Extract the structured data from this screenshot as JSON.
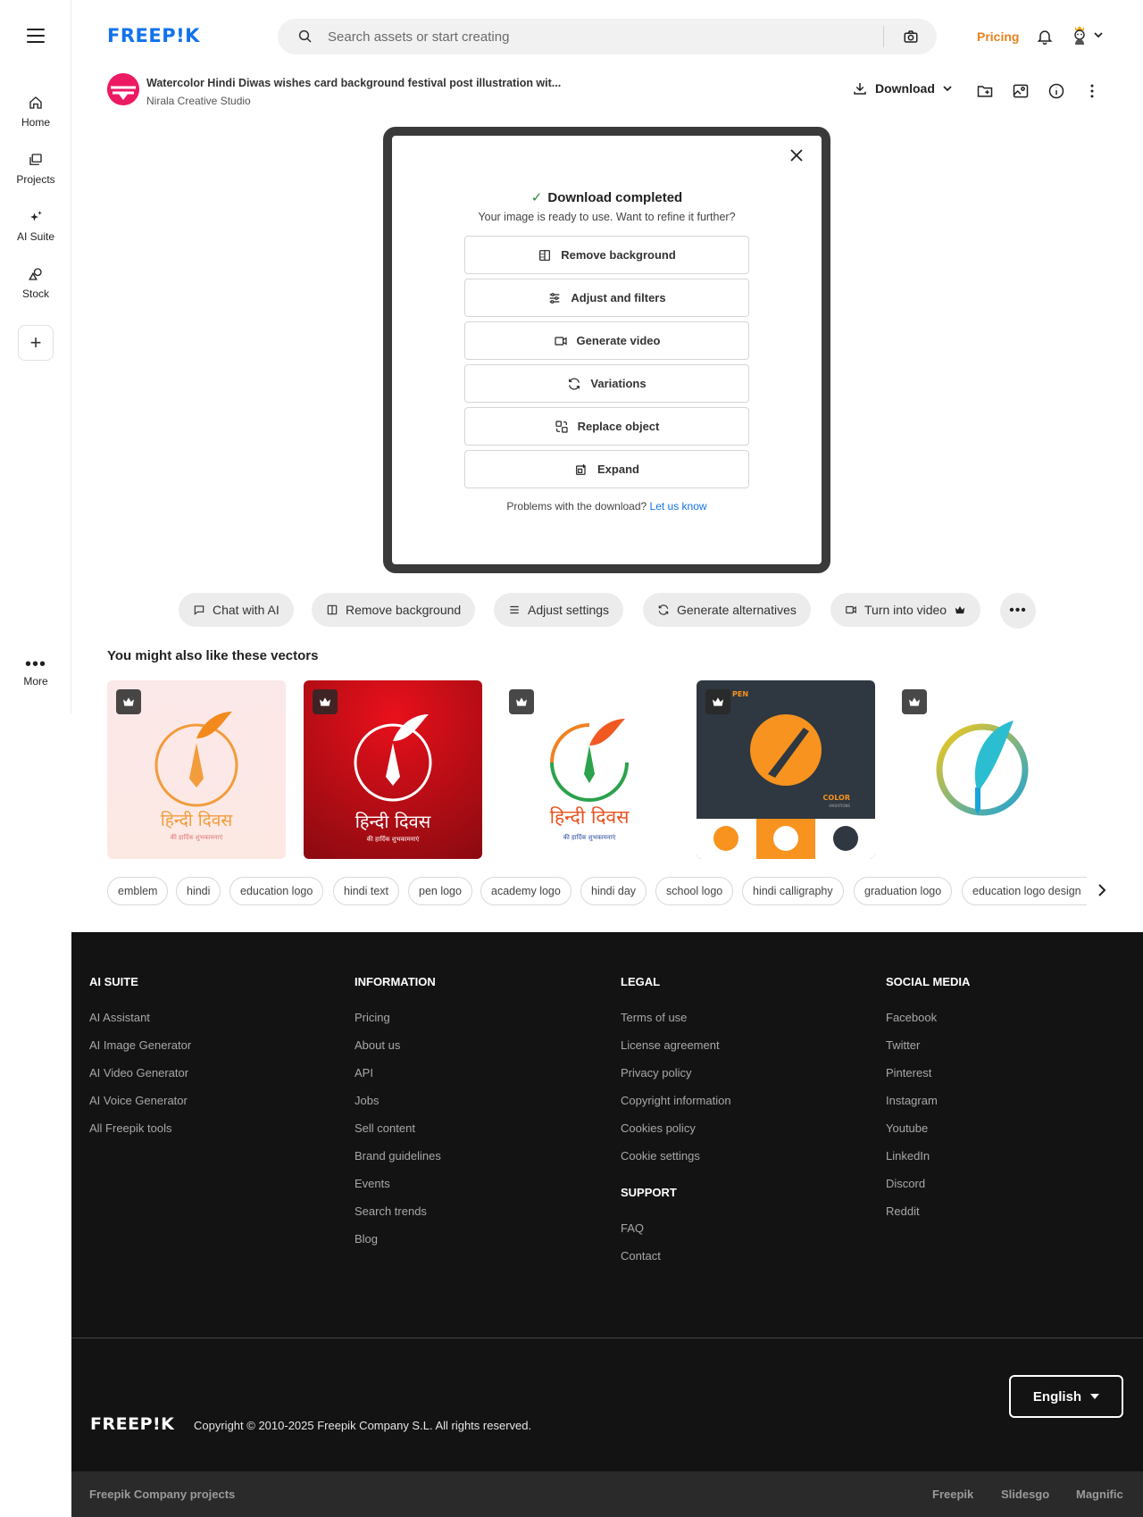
{
  "sidebar": {
    "items": [
      {
        "label": "Home",
        "icon": "home-icon"
      },
      {
        "label": "Projects",
        "icon": "projects-icon"
      },
      {
        "label": "AI Suite",
        "icon": "sparkles-icon"
      },
      {
        "label": "Stock",
        "icon": "shapes-icon"
      }
    ],
    "more_label": "More"
  },
  "header": {
    "logo": "FREEP!K",
    "search_placeholder": "Search assets or start creating",
    "pricing_label": "Pricing"
  },
  "asset": {
    "title": "Watercolor Hindi Diwas wishes card background festival post illustration wit...",
    "author": "Nirala Creative Studio",
    "download_label": "Download"
  },
  "modal": {
    "title": "Download completed",
    "subtitle": "Your image is ready to use. Want to refine it further?",
    "options": [
      {
        "label": "Remove background",
        "icon": "remove-background-icon"
      },
      {
        "label": "Adjust and filters",
        "icon": "sliders-icon"
      },
      {
        "label": "Generate video",
        "icon": "video-icon"
      },
      {
        "label": "Variations",
        "icon": "refresh-icon"
      },
      {
        "label": "Replace object",
        "icon": "replace-icon"
      },
      {
        "label": "Expand",
        "icon": "expand-icon"
      }
    ],
    "footer_text": "Problems with the download?",
    "footer_link": "Let us know"
  },
  "actions": [
    {
      "label": "Chat with AI",
      "icon": "chat-icon"
    },
    {
      "label": "Remove background",
      "icon": "remove-background-icon"
    },
    {
      "label": "Adjust settings",
      "icon": "sliders-icon"
    },
    {
      "label": "Generate alternatives",
      "icon": "refresh-icon"
    },
    {
      "label": "Turn into video",
      "icon": "video-icon"
    }
  ],
  "related": {
    "title": "You might also like these vectors",
    "thumbs": [
      {
        "caption": "हिन्दी दिवस",
        "sub": "की हार्दिक शुभकामनाएं",
        "theme": "light"
      },
      {
        "caption": "हिन्दी दिवस",
        "sub": "की हार्दिक शुभकामनाएं",
        "theme": "red"
      },
      {
        "caption": "हिन्दी दिवस",
        "sub": "की हार्दिक शुभकामनाएं",
        "theme": "white"
      },
      {
        "badge_top": "PEN",
        "badge_bottom": "COLOR",
        "badge_sub": "VARIATIONS",
        "theme": "dark"
      },
      {
        "theme": "gradient"
      }
    ]
  },
  "tags": [
    "emblem",
    "hindi",
    "education logo",
    "hindi text",
    "pen logo",
    "academy logo",
    "hindi day",
    "school logo",
    "hindi calligraphy",
    "graduation logo",
    "education logo design"
  ],
  "footer": {
    "columns": [
      {
        "heading": "AI SUITE",
        "links": [
          "AI Assistant",
          "AI Image Generator",
          "AI Video Generator",
          "AI Voice Generator",
          "All Freepik tools"
        ]
      },
      {
        "heading": "INFORMATION",
        "links": [
          "Pricing",
          "About us",
          "API",
          "Jobs",
          "Sell content",
          "Brand guidelines",
          "Events",
          "Search trends",
          "Blog"
        ]
      },
      {
        "heading": "LEGAL",
        "links": [
          "Terms of use",
          "License agreement",
          "Privacy policy",
          "Copyright information",
          "Cookies policy",
          "Cookie settings"
        ],
        "sub_heading": "SUPPORT",
        "sub_links": [
          "FAQ",
          "Contact"
        ]
      },
      {
        "heading": "SOCIAL MEDIA",
        "links": [
          "Facebook",
          "Twitter",
          "Pinterest",
          "Instagram",
          "Youtube",
          "LinkedIn",
          "Discord",
          "Reddit"
        ]
      }
    ],
    "language": "English",
    "logo": "FREEP!K",
    "copyright": "Copyright © 2010-2025 Freepik Company S.L. All rights reserved.",
    "company_projects_label": "Freepik Company projects",
    "projects": [
      "Freepik",
      "Slidesgo",
      "Magnific"
    ]
  },
  "colors": {
    "brand_blue": "#1273eb",
    "pricing_orange": "#e8821e",
    "footer_bg": "#131313",
    "check_green": "#2a8a3a"
  }
}
